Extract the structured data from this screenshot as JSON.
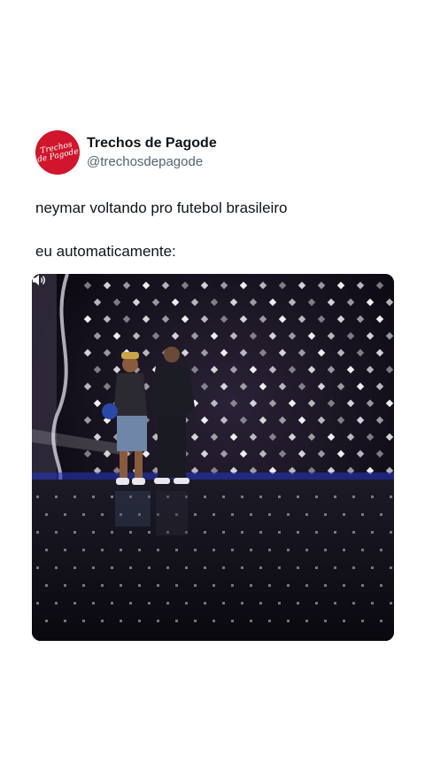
{
  "author": {
    "display_name": "Trechos de Pagode",
    "handle": "@trechosdepagode",
    "avatar_logo_text": "Trechos\nde Pagode",
    "avatar_color": "#d1152c"
  },
  "tweet": {
    "line1": "neymar voltando pro futebol brasileiro",
    "line2": "eu automaticamente:"
  },
  "media": {
    "type": "video",
    "sound_icon": "speaker-icon"
  },
  "colors": {
    "text_primary": "#0f1419",
    "text_secondary": "#536471",
    "background": "#ffffff"
  }
}
